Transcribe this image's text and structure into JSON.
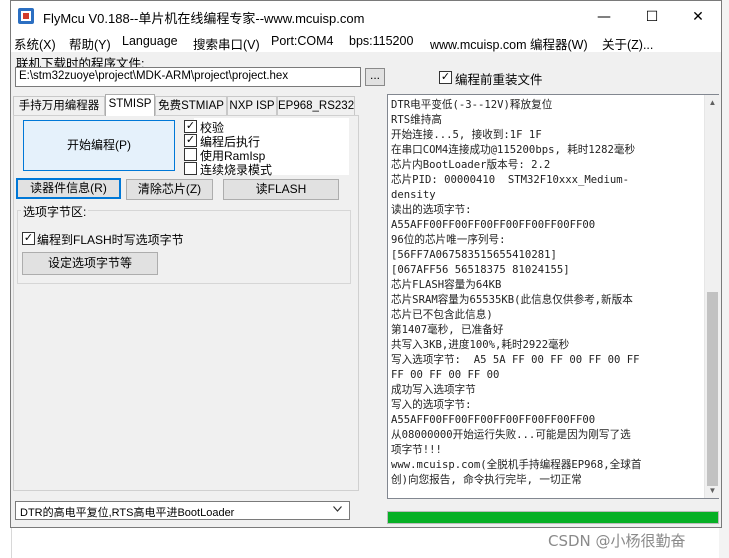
{
  "window": {
    "title": "FlyMcu V0.188--单片机在线编程专家--www.mcuisp.com",
    "minimize_glyph": "—",
    "maximize_glyph": "☐",
    "close_glyph": "✕"
  },
  "menu": [
    "系统(X)",
    "帮助(Y)",
    "Language",
    "搜索串口(V)",
    "Port:COM4",
    "bps:115200",
    "www.mcuisp.com 编程器(W)",
    "关于(Z)..."
  ],
  "file": {
    "label": "联机下载时的程序文件:",
    "path": "E:\\stm32zuoye\\project\\MDK-ARM\\project\\project.hex",
    "browse_label": "...",
    "reload_label": "编程前重装文件",
    "reload_checked": "✓"
  },
  "tabs": [
    "手持万用编程器",
    "STMISP",
    "免费STMIAP",
    "NXP ISP",
    "EP968_RS232"
  ],
  "stmisp": {
    "start_button": "开始编程(P)",
    "options": [
      {
        "label": "校验",
        "checked": "✓"
      },
      {
        "label": "编程后执行",
        "checked": "✓"
      },
      {
        "label": "使用RamIsp",
        "checked": ""
      },
      {
        "label": "连续烧录模式",
        "checked": ""
      }
    ],
    "read_info_button": "读器件信息(R)",
    "clear_chip_button": "清除芯片(Z)",
    "read_flash_button": "读FLASH",
    "option_bytes_group": "选项字节区:",
    "write_option_label": "编程到FLASH时写选项字节",
    "write_option_checked": "✓",
    "set_option_button": "设定选项字节等"
  },
  "reset_mode": "DTR的高电平复位,RTS高电平进BootLoader",
  "log_lines": [
    "DTR电平变低(-3--12V)释放复位",
    "RTS维持高",
    "开始连接...5, 接收到:1F 1F",
    "在串口COM4连接成功@115200bps, 耗时1282毫秒",
    "芯片内BootLoader版本号: 2.2",
    "芯片PID: 00000410  STM32F10xxx_Medium-",
    "density",
    "读出的选项字节:",
    "A55AFF00FF00FF00FF00FF00FF00FF00",
    "96位的芯片唯一序列号:",
    "[56FF7A067583515655410281]",
    "[067AFF56 56518375 81024155]",
    "芯片FLASH容量为64KB",
    "芯片SRAM容量为65535KB(此信息仅供参考,新版本",
    "芯片已不包含此信息)",
    "第1407毫秒, 已准备好",
    "共写入3KB,进度100%,耗时2922毫秒",
    "写入选项字节:  A5 5A FF 00 FF 00 FF 00 FF",
    "FF 00 FF 00 FF 00",
    "成功写入选项字节",
    "写入的选项字节:",
    "A55AFF00FF00FF00FF00FF00FF00FF00",
    "从08000000开始运行失败...可能是因为刚写了选",
    "项字节!!!",
    "www.mcuisp.com(全脱机手持编程器EP968,全球首",
    "创)向您报告, 命令执行完毕, 一切正常"
  ],
  "progress_fraction": 1.0,
  "watermark": "CSDN @小杨很勤奋",
  "colors": {
    "progress": "#06b025",
    "focus_border": "#0078d7",
    "start_button_bg": "#e5f1fb"
  }
}
